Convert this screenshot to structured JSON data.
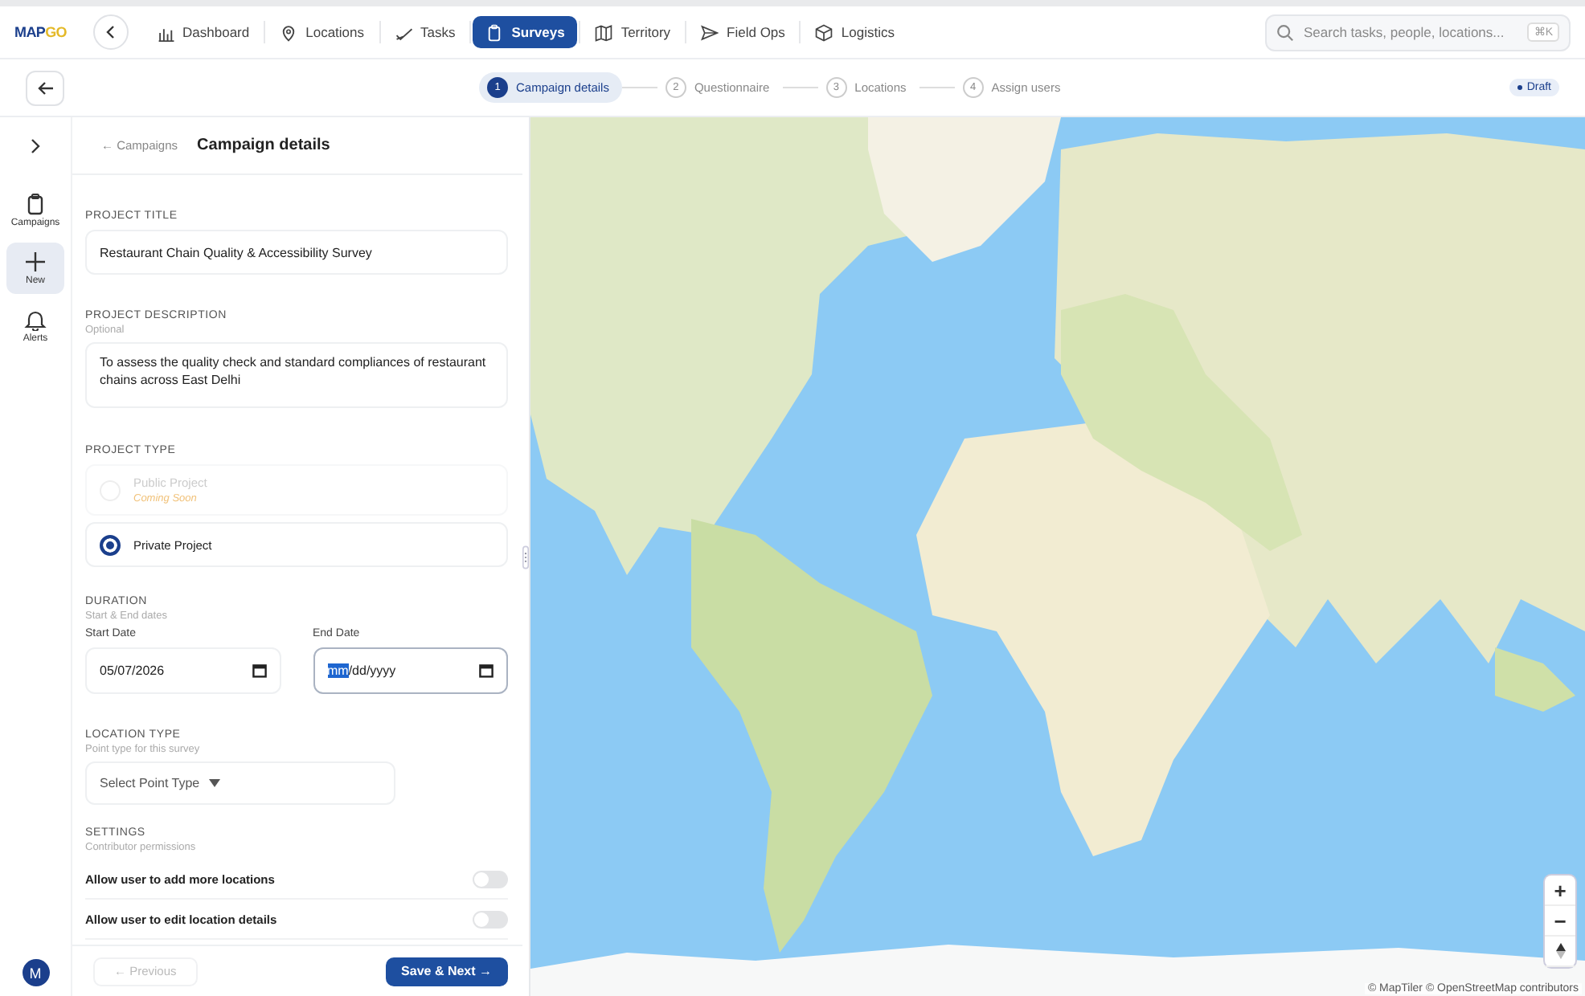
{
  "logo": {
    "main": "MAP",
    "accent": "GO"
  },
  "nav": [
    {
      "label": "Dashboard",
      "kind": "chart",
      "selected": false
    },
    {
      "label": "Locations",
      "kind": "pin",
      "selected": false
    },
    {
      "label": "Tasks",
      "kind": "check",
      "selected": false
    },
    {
      "label": "Surveys",
      "kind": "clipboard",
      "selected": true
    },
    {
      "label": "Territory",
      "kind": "map",
      "selected": false
    },
    {
      "label": "Field Ops",
      "kind": "send",
      "selected": false
    },
    {
      "label": "Logistics",
      "kind": "box",
      "selected": false
    }
  ],
  "search": {
    "placeholder": "Search tasks, people, locations...",
    "shortcut": "⌘K"
  },
  "steps": [
    {
      "number": "1",
      "label": "Campaign details",
      "selected": true
    },
    {
      "number": "2",
      "label": "Questionnaire",
      "selected": false
    },
    {
      "number": "3",
      "label": "Locations",
      "selected": false
    },
    {
      "number": "4",
      "label": "Assign users",
      "selected": false
    }
  ],
  "status_badge": "Draft",
  "rail": [
    {
      "label": "Campaigns",
      "kind": "clipboard",
      "selected": false
    },
    {
      "label": "New",
      "kind": "plus",
      "selected": true
    },
    {
      "label": "Alerts",
      "kind": "bell",
      "selected": false
    }
  ],
  "avatar": "M",
  "panel": {
    "back_link": "← Campaigns",
    "title": "Campaign details"
  },
  "form": {
    "title": {
      "label": "PROJECT TITLE",
      "value": "Restaurant Chain Quality & Accessibility Survey"
    },
    "description": {
      "label": "PROJECT DESCRIPTION",
      "hint": "Optional",
      "value": "To assess the quality check and standard compliances of restaurant chains across East Delhi"
    },
    "project_type": {
      "label": "PROJECT TYPE",
      "options": [
        {
          "label": "Public Project",
          "note": "Coming Soon",
          "disabled": true,
          "selected": false
        },
        {
          "label": "Private Project",
          "disabled": false,
          "selected": true
        }
      ]
    },
    "duration": {
      "label": "DURATION",
      "hint": "Start & End dates",
      "start": {
        "label": "Start Date",
        "value": "05/07/2026",
        "focused": false
      },
      "end": {
        "label": "End Date",
        "segments": [
          "mm",
          "/dd/yyyy"
        ],
        "focused": true
      }
    },
    "location_type": {
      "label": "LOCATION TYPE",
      "hint": "Point type for this survey",
      "placeholder": "Select Point Type"
    },
    "settings": {
      "label": "SETTINGS",
      "hint": "Contributor permissions",
      "toggles": [
        {
          "label": "Allow user to add more locations",
          "on": false
        },
        {
          "label": "Allow user to edit location details",
          "on": false
        }
      ]
    }
  },
  "footer": {
    "previous": {
      "label": "← Previous",
      "disabled": true
    },
    "next": "Save & Next →"
  },
  "map": {
    "kind": "picture",
    "attribution": "© MapTiler © OpenStreetMap contributors",
    "controls": [
      "+",
      "−"
    ]
  }
}
